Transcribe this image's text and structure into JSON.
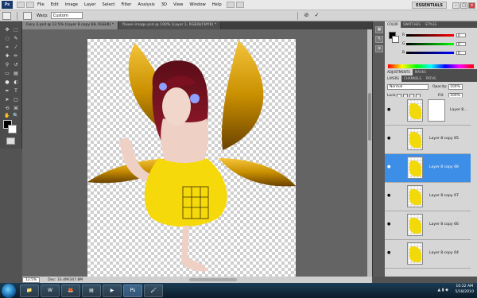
{
  "app": {
    "logo": "Ps",
    "menu": [
      "File",
      "Edit",
      "Image",
      "Layer",
      "Select",
      "Filter",
      "Analysis",
      "3D",
      "View",
      "Window",
      "Help"
    ],
    "workspace": "ESSENTIALS",
    "window_controls": [
      "–",
      "□",
      "×"
    ]
  },
  "options_bar": {
    "warp_label": "Warp:",
    "warp_value": "Custom",
    "cancel_icon": "⊘",
    "commit_icon": "✓"
  },
  "tabs": [
    {
      "label": "Fairy 3.psd @ 12.5% (Layer 8 copy 68, RGB/8) *",
      "active": true
    },
    {
      "label": "flower-image.psd @ 100% (Layer 1, RGB/8/CMYK) *",
      "active": false
    }
  ],
  "status": {
    "zoom": "12.5%",
    "doc": "Doc: 33.4M/347.8M"
  },
  "panels": {
    "color_tabs": [
      "COLOR",
      "SWATCHES",
      "STYLES"
    ],
    "color_channels": [
      {
        "ch": "R",
        "value": "0",
        "gradient": "#ff0000"
      },
      {
        "ch": "G",
        "value": "0",
        "gradient": "#00ff00"
      },
      {
        "ch": "B",
        "value": "0",
        "gradient": "#0000ff"
      }
    ],
    "adjust_tabs": [
      "ADJUSTMENTS",
      "MASKS"
    ],
    "layers_tabs": [
      "LAYERS",
      "CHANNELS",
      "PATHS"
    ],
    "blend_mode": "Normal",
    "opacity_label": "Opacity:",
    "opacity_value": "100%",
    "lock_label": "Lock:",
    "fill_label": "Fill:",
    "fill_value": "100%",
    "layers": [
      {
        "name": "Layer 8...",
        "has_mask": true,
        "selected": false
      },
      {
        "name": "Layer 8 copy 65",
        "has_mask": false,
        "selected": false
      },
      {
        "name": "Layer 8 copy 68",
        "has_mask": false,
        "selected": true
      },
      {
        "name": "Layer 8 copy 67",
        "has_mask": false,
        "selected": false
      },
      {
        "name": "Layer 8 copy 66",
        "has_mask": false,
        "selected": false
      },
      {
        "name": "Layer 8 copy 64",
        "has_mask": false,
        "selected": false
      }
    ]
  },
  "taskbar": {
    "apps": [
      "📁",
      "W",
      "🦊",
      "▤",
      "▶",
      "Ps",
      "🖌"
    ],
    "time": "10:22 AM",
    "date": "5/18/2010"
  },
  "colors": {
    "wing": "#d99a00",
    "dress": "#f5d90a",
    "hair": "#7a1020",
    "skin": "#f0d2c8",
    "selection_blue": "#3d8ee6"
  }
}
